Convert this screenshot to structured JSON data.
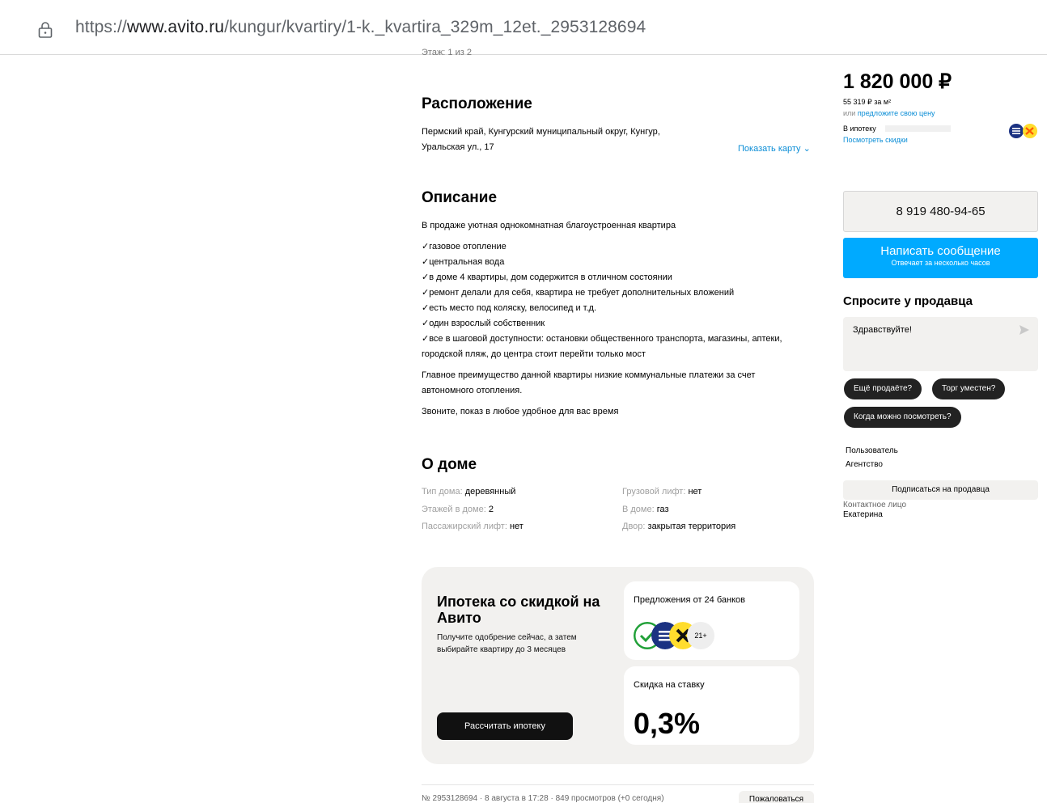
{
  "browser": {
    "url_prefix": "https://",
    "url_domain": "www.avito.ru",
    "url_path": "/kungur/kvartiry/1-k._kvartira_329m_12et._2953128694"
  },
  "cut_text": "Этаж: 1 из 2",
  "location": {
    "title": "Расположение",
    "address_line1": "Пермский край, Кунгурский муниципальный округ, Кунгур,",
    "address_line2": "Уральская ул., 17",
    "show_map": "Показать карту"
  },
  "description": {
    "title": "Описание",
    "intro": "В продаже уютная однокомнатная благоустроенная квартира",
    "items": [
      "✓газовое отопление",
      "✓центральная вода",
      "✓в доме 4 квартиры, дом содержится в отличном состоянии",
      "✓ремонт делали для себя, квартира не требует дополнительных вложений",
      "✓есть место под коляску, велосипед и т.д.",
      "✓один взрослый собственник",
      "✓все в шаговой доступности: остановки общественного транспорта, магазины, аптеки, городской пляж, до центра стоит перейти только мост"
    ],
    "advantage": "Главное преимущество данной квартиры низкие коммунальные платежи за счет автономного отопления.",
    "call": "Звоните, показ в любое удобное для вас время"
  },
  "house": {
    "title": "О доме",
    "left": [
      {
        "label": "Тип дома: ",
        "value": "деревянный"
      },
      {
        "label": "Этажей в доме: ",
        "value": "2"
      },
      {
        "label": "Пассажирский лифт: ",
        "value": "нет"
      }
    ],
    "right": [
      {
        "label": "Грузовой лифт: ",
        "value": "нет"
      },
      {
        "label": "В доме: ",
        "value": "газ"
      },
      {
        "label": "Двор: ",
        "value": "закрытая территория"
      }
    ]
  },
  "mortgage_card": {
    "title": "Ипотека со скидкой на Авито",
    "subtitle": "Получите одобрение сейчас, а затем выбирайте квартиру до 3 месяцев",
    "button": "Рассчитать ипотеку",
    "banks_label": "Предложения от 24 банков",
    "banks_more": "21+",
    "discount_label": "Скидка на ставку",
    "discount_value": "0,3%"
  },
  "footer": {
    "meta": "№ 2953128694 · 8 августа в 17:28 · 849 просмотров (+0 сегодня)",
    "complain": "Пожаловаться"
  },
  "sidebar": {
    "price": "1 820 000 ₽",
    "price_per_m": "55 319 ₽ за м²",
    "offer_prefix": "или ",
    "offer_link": "предложите свою цену",
    "mortgage_label": "В ипотеку",
    "discounts_link": "Посмотреть скидки",
    "phone": "8 919 480-94-65",
    "message_button": "Написать сообщение",
    "message_sub": "Отвечает за несколько часов",
    "ask_title": "Спросите у продавца",
    "ask_placeholder": "Здравствуйте!",
    "chips": [
      "Ещё продаёте?",
      "Торг уместен?",
      "Когда можно посмотреть?"
    ],
    "seller_type": "Пользователь",
    "seller_name": "Агентство",
    "subscribe": "Подписаться на продавца",
    "contact_label": "Контактное лицо",
    "contact_name": "Екатерина"
  },
  "colors": {
    "link_blue": "#0a8dd6",
    "message_button": "#00aaff",
    "card_bg": "#f2f1ef"
  }
}
